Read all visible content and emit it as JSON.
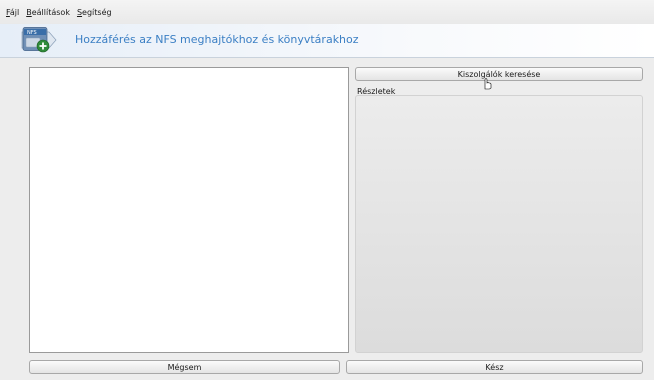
{
  "menubar": {
    "items": [
      {
        "accel": "F",
        "rest": "ájl"
      },
      {
        "accel": "B",
        "rest": "eállítások"
      },
      {
        "accel": "S",
        "rest": "egítség"
      }
    ]
  },
  "banner": {
    "icon_label": "NFS",
    "title": "Hozzáférés az NFS meghajtókhoz és könyvtárakhoz"
  },
  "right_panel": {
    "search_button": "Kiszolgálók keresése",
    "details_label": "Részletek"
  },
  "footer": {
    "cancel_button": "Mégsem",
    "done_button": "Kész"
  },
  "colors": {
    "title": "#3b7fc4",
    "icon_badge": "#2f8a3a"
  }
}
